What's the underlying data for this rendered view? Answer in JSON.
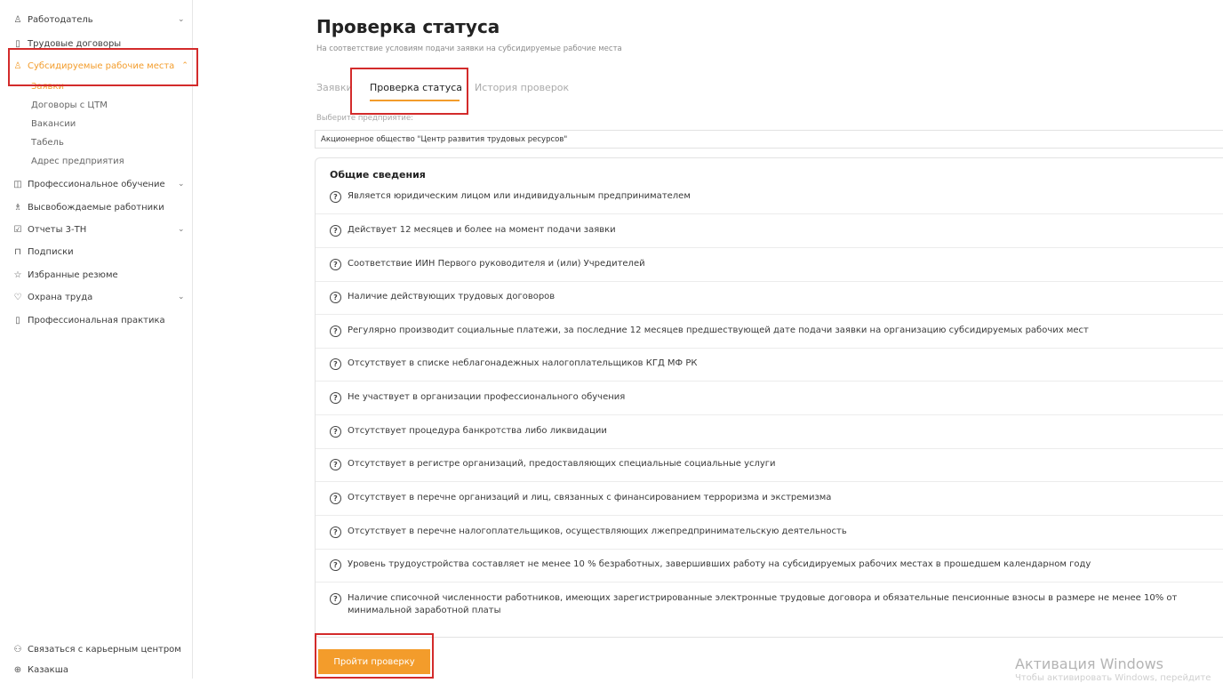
{
  "sidebar": {
    "employer": "Работодатель",
    "contracts": "Трудовые договоры",
    "subsidized": "Субсидируемые рабочие места",
    "sub_items": [
      "Заявки",
      "Договоры с ЦТМ",
      "Вакансии",
      "Табель",
      "Адрес предприятия"
    ],
    "training": "Профессиональное обучение",
    "released": "Высвобождаемые работники",
    "reports": "Отчеты 3-ТН",
    "subscriptions": "Подписки",
    "favorites": "Избранные резюме",
    "safety": "Охрана труда",
    "practice": "Профессиональная практика",
    "contact": "Связаться с карьерным центром",
    "language": "Казакша"
  },
  "page": {
    "title": "Проверка статуса",
    "subtitle": "На соответствие условиям подачи заявки на субсидируемые рабочие места"
  },
  "tabs": [
    "Заявки",
    "Проверка статуса",
    "История проверок"
  ],
  "company": {
    "label": "Выберите предприятие:",
    "value": "Акционерное общество \"Центр развития трудовых ресурсов\""
  },
  "checks": {
    "title": "Общие сведения",
    "items": [
      "Является юридическим лицом или индивидуальным предпринимателем",
      "Действует 12 месяцев и более на момент подачи заявки",
      "Соответствие ИИН Первого руководителя и (или) Учредителей",
      "Наличие действующих трудовых договоров",
      "Регулярно производит социальные платежи, за последние 12 месяцев предшествующей дате подачи заявки на организацию субсидируемых рабочих мест",
      "Отсутствует в списке неблагонадежных налогоплательщиков КГД МФ РК",
      "Не участвует в организации профессионального обучения",
      "Отсутствует процедура банкротства либо ликвидации",
      "Отсутствует в регистре организаций, предоставляющих специальные социальные услуги",
      "Отсутствует в перечне организаций и лиц, связанных с финансированием терроризма и экстремизма",
      "Отсутствует в перечне налогоплательщиков, осуществляющих лжепредпринимательскую деятельность",
      "Уровень трудоустройства составляет не менее 10 % безработных, завершивших работу на субсидируемых рабочих местах в прошедшем календарном году",
      "Наличие списочной численности работников, имеющих зарегистрированные электронные трудовые договора и обязательные пенсионные взносы в размере не менее 10% от минимальной заработной платы"
    ]
  },
  "submit_label": "Пройти проверку",
  "watermark": {
    "line1": "Активация Windows",
    "line2": "Чтобы активировать Windows, перейдите"
  },
  "colors": {
    "accent": "#f39c2b",
    "highlight": "#d32b2b"
  }
}
